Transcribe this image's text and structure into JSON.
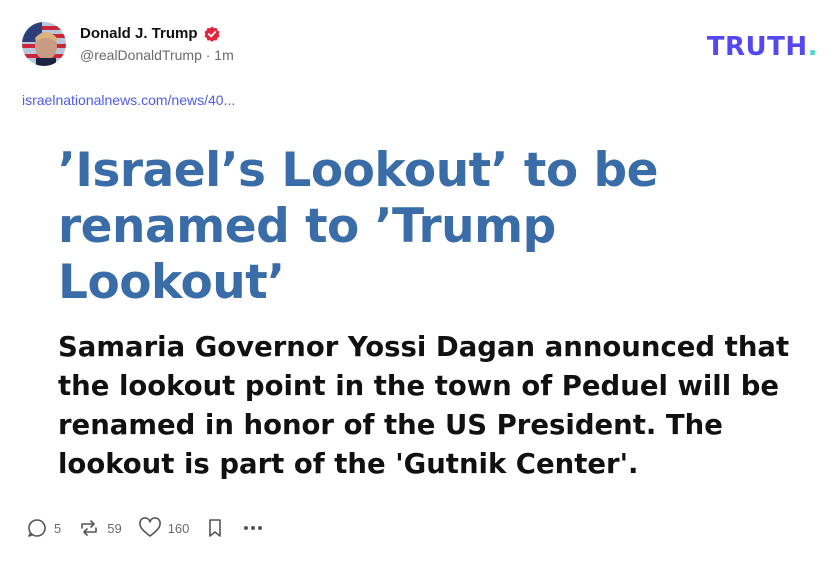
{
  "post": {
    "author_name": "Donald J. Trump",
    "handle_and_time": "@realDonaldTrump · 1m",
    "brand": "TRUTH",
    "brand_dot": ".",
    "link": "israelnationalnews.com/news/40...",
    "headline": "’Israel’s Lookout’ to be renamed to ’Trump Lookout’",
    "summary": "Samaria Governor Yossi Dagan announced that the lookout point in the town of Peduel will be renamed in honor of the US President. The lookout is part of the 'Gutnik Center'."
  },
  "actions": {
    "replies": "5",
    "retruths": "59",
    "likes": "160"
  },
  "icons": [
    "avatar",
    "verified-badge-icon",
    "reply-icon",
    "retruth-icon",
    "heart-icon",
    "bookmark-icon",
    "more-icon"
  ],
  "colors": {
    "brand": "#5448ee",
    "brand_dot": "#4fd7c3",
    "headline": "#3a6ca7",
    "link": "#4d5bf0",
    "verified": "#e5243b"
  }
}
